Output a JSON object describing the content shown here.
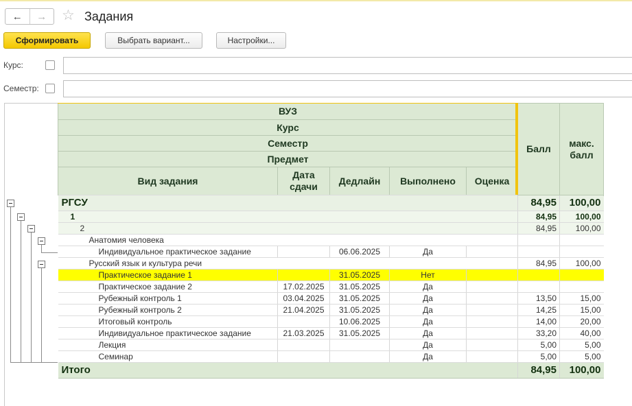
{
  "window": {
    "title": "Задания"
  },
  "nav": {
    "back": "←",
    "forward": "→",
    "favorite": "☆"
  },
  "toolbar": {
    "generate_label": "Сформировать",
    "variant_label": "Выбрать вариант...",
    "settings_label": "Настройки..."
  },
  "filters": {
    "course_label": "Курс:",
    "course_value": "",
    "semester_label": "Семестр:",
    "semester_value": ""
  },
  "report": {
    "headers": {
      "vuz": "ВУЗ",
      "kurs": "Курс",
      "semestr": "Семестр",
      "predmet": "Предмет",
      "vid": "Вид задания",
      "data_sdachi": "Дата сдачи",
      "dedlain": "Дедлайн",
      "vypolneno": "Выполнено",
      "ocenka": "Оценка",
      "ball": "Балл",
      "maks_ball": "макс. балл"
    },
    "groups": {
      "vuz": {
        "label": "РГСУ",
        "ball": "84,95",
        "max": "100,00"
      },
      "kurs": {
        "label": "1",
        "ball": "84,95",
        "max": "100,00"
      },
      "semestr": {
        "label": "2",
        "ball": "84,95",
        "max": "100,00"
      },
      "subject1": {
        "label": "Анатомия человека",
        "ball": "",
        "max": ""
      },
      "subject2": {
        "label": "Русский язык и культура речи",
        "ball": "84,95",
        "max": "100,00"
      }
    },
    "subject1_rows": [
      {
        "vid": "Индивидуальное практическое задание",
        "data": "",
        "dedlain": "06.06.2025",
        "vyp": "Да",
        "ocenka": "",
        "ball": "",
        "max": ""
      }
    ],
    "subject2_rows": [
      {
        "vid": "Практическое задание 1",
        "data": "",
        "dedlain": "31.05.2025",
        "vyp": "Нет",
        "ocenka": "",
        "ball": "",
        "max": ""
      },
      {
        "vid": "Практическое задание 2",
        "data": "17.02.2025",
        "dedlain": "31.05.2025",
        "vyp": "Да",
        "ocenka": "",
        "ball": "",
        "max": ""
      },
      {
        "vid": "Рубежный контроль 1",
        "data": "03.04.2025",
        "dedlain": "31.05.2025",
        "vyp": "Да",
        "ocenka": "",
        "ball": "13,50",
        "max": "15,00"
      },
      {
        "vid": "Рубежный контроль 2",
        "data": "21.04.2025",
        "dedlain": "31.05.2025",
        "vyp": "Да",
        "ocenka": "",
        "ball": "14,25",
        "max": "15,00"
      },
      {
        "vid": "Итоговый контроль",
        "data": "",
        "dedlain": "10.06.2025",
        "vyp": "Да",
        "ocenka": "",
        "ball": "14,00",
        "max": "20,00"
      },
      {
        "vid": "Индивидуальное практическое задание",
        "data": "21.03.2025",
        "dedlain": "31.05.2025",
        "vyp": "Да",
        "ocenka": "",
        "ball": "33,20",
        "max": "40,00"
      },
      {
        "vid": "Лекция",
        "data": "",
        "dedlain": "",
        "vyp": "Да",
        "ocenka": "",
        "ball": "5,00",
        "max": "5,00"
      },
      {
        "vid": "Семинар",
        "data": "",
        "dedlain": "",
        "vyp": "Да",
        "ocenka": "",
        "ball": "5,00",
        "max": "5,00"
      }
    ],
    "total": {
      "label": "Итого",
      "ball": "84,95",
      "max": "100,00"
    }
  },
  "colors": {
    "highlight": "#ffff00",
    "header_bg": "#dce9d4",
    "primary_button": "#f4c800"
  }
}
